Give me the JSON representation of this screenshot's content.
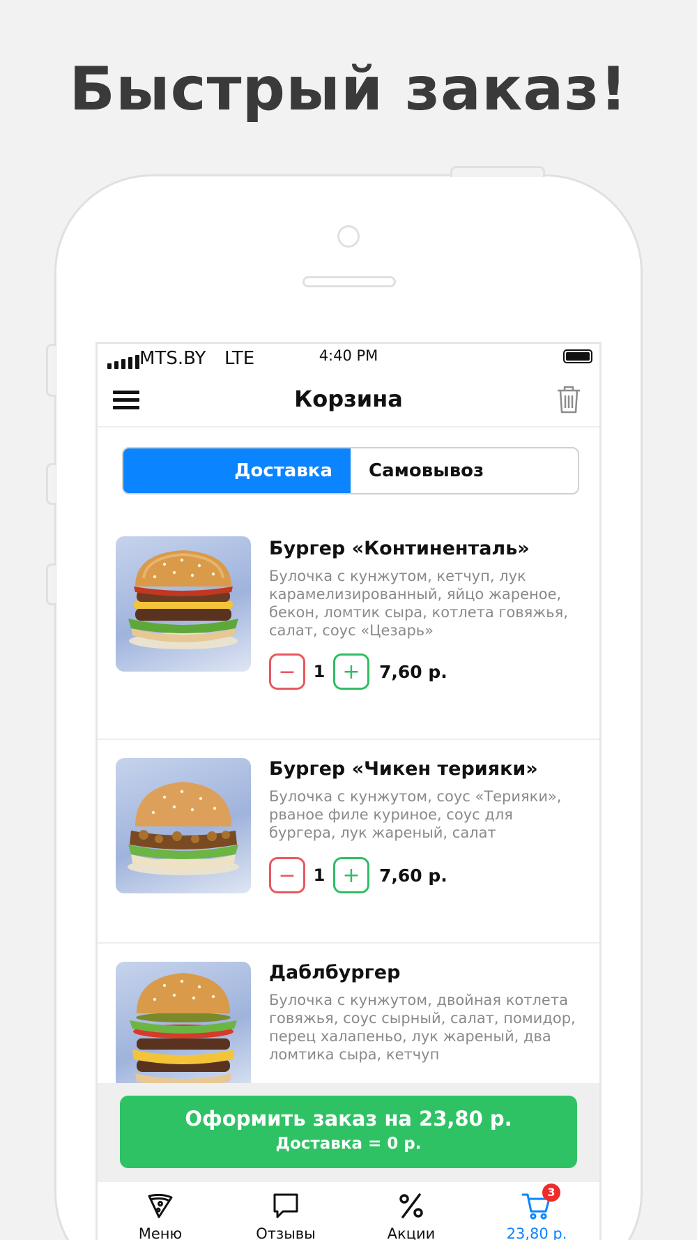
{
  "headline": "Быстрый заказ!",
  "status_bar": {
    "carrier": "MTS.BY",
    "network": "LTE",
    "time": "4:40 PM"
  },
  "nav": {
    "title": "Корзина"
  },
  "segmented": {
    "delivery": "Доставка",
    "pickup": "Самовывоз",
    "selected": "delivery"
  },
  "cart_items": [
    {
      "name": "Бургер «Континенталь»",
      "description": "Булочка с кунжутом, кетчуп, лук карамелизированный, яйцо жареное, бекон, ломтик сыра, котлета говяжья, салат, соус «Цезарь»",
      "quantity": "1",
      "price": "7,60 р."
    },
    {
      "name": "Бургер «Чикен терияки»",
      "description": "Булочка с кунжутом, соус «Терияки», рваное филе куриное, соус для бургера, лук жареный, салат",
      "quantity": "1",
      "price": "7,60 р."
    },
    {
      "name": "Даблбургер",
      "description": "Булочка с кунжутом, двойная котлета говяжья, соус сырный, салат, помидор, перец халапеньо, лук жареный, два ломтика сыра, кетчуп"
    }
  ],
  "order_button": {
    "main": "Оформить заказ на 23,80 р.",
    "sub": "Доставка = 0 р."
  },
  "tabbar": {
    "menu": "Меню",
    "reviews": "Отзывы",
    "promos": "Акции",
    "cart": "23,80 р.",
    "cart_badge": "3"
  },
  "colors": {
    "accent": "#0a84ff",
    "order": "#2ec265",
    "minus": "#e8585f",
    "plus": "#2ebd64",
    "badge": "#ef2b2b"
  }
}
